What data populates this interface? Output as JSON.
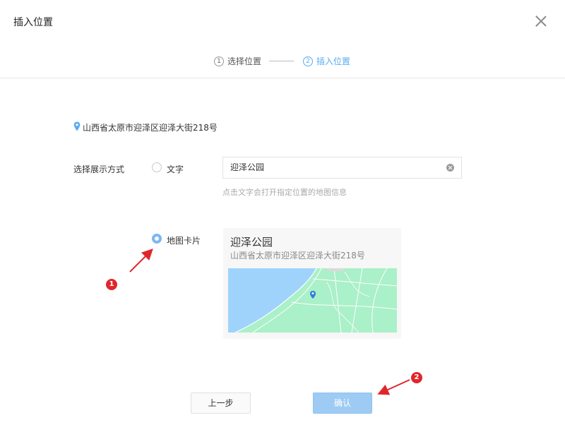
{
  "dialog": {
    "title": "插入位置"
  },
  "steps": [
    {
      "num": "1",
      "label": "选择位置"
    },
    {
      "num": "2",
      "label": "插入位置"
    }
  ],
  "location": {
    "address": "山西省太原市迎泽区迎泽大街218号"
  },
  "display_mode": {
    "label": "选择展示方式",
    "option_text": "文字",
    "option_card": "地图卡片",
    "selected": "地图卡片",
    "text_input_value": "迎泽公园",
    "hint": "点击文字会打开指定位置的地图信息"
  },
  "map_card": {
    "title": "迎泽公园",
    "address": "山西省太原市迎泽区迎泽大街218号"
  },
  "annotations": {
    "badge1": "1",
    "badge2": "2"
  },
  "footer": {
    "prev_label": "上一步",
    "ok_label": "确认"
  },
  "colors": {
    "accent": "#5aabf2",
    "primary_button": "#9ecbf3",
    "annotation": "#e0262b",
    "map_water": "#9fd3fb",
    "map_land": "#aaf0c8"
  }
}
